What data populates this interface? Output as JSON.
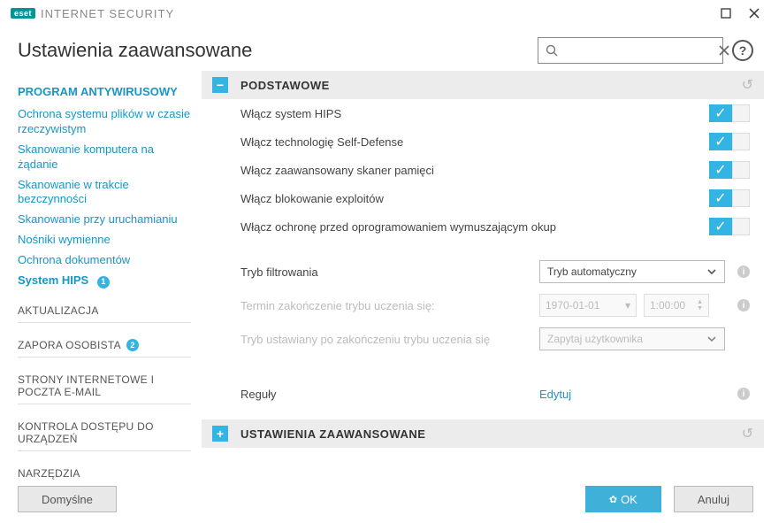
{
  "app": {
    "brand": "eset",
    "product": "INTERNET SECURITY"
  },
  "page_title": "Ustawienia zaawansowane",
  "search": {
    "placeholder": ""
  },
  "sidebar": {
    "heading": "PROGRAM ANTYWIRUSOWY",
    "items": [
      "Ochrona systemu plików w czasie rzeczywistym",
      "Skanowanie komputera na żądanie",
      "Skanowanie w trakcie bezczynności",
      "Skanowanie przy uruchamianiu",
      "Nośniki wymienne",
      "Ochrona dokumentów",
      "System HIPS"
    ],
    "active_badge": "1",
    "sections": [
      {
        "label": "AKTUALIZACJA",
        "badge": ""
      },
      {
        "label": "ZAPORA OSOBISTA",
        "badge": "2"
      },
      {
        "label": "STRONY INTERNETOWE I POCZTA E-MAIL",
        "badge": ""
      },
      {
        "label": "KONTROLA DOSTĘPU DO URZĄDZEŃ",
        "badge": ""
      },
      {
        "label": "NARZĘDZIA",
        "badge": ""
      }
    ]
  },
  "sections": {
    "basic": {
      "title": "PODSTAWOWE",
      "toggles": [
        "Włącz system HIPS",
        "Włącz technologię Self-Defense",
        "Włącz zaawansowany skaner pamięci",
        "Włącz blokowanie exploitów",
        "Włącz ochronę przed oprogramowaniem wymuszającym okup"
      ],
      "filter_mode_label": "Tryb filtrowania",
      "filter_mode_value": "Tryb automatyczny",
      "learn_end_label": "Termin zakończenie trybu uczenia się:",
      "learn_end_date": "1970-01-01",
      "learn_end_time": "1:00:00",
      "after_learn_label": "Tryb ustawiany po zakończeniu trybu uczenia się",
      "after_learn_value": "Zapytaj użytkownika",
      "rules_label": "Reguły",
      "rules_action": "Edytuj"
    },
    "advanced": {
      "title": "USTAWIENIA ZAAWANSOWANE"
    }
  },
  "footer": {
    "default": "Domyślne",
    "ok": "OK",
    "cancel": "Anuluj"
  }
}
